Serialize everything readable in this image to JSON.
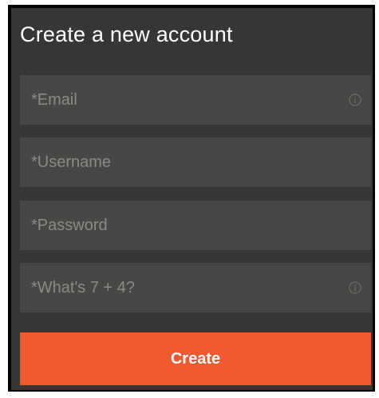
{
  "form": {
    "title": "Create a new account",
    "fields": [
      {
        "placeholder": "*Email",
        "value": "",
        "has_info_icon": true,
        "icon": "info-icon"
      },
      {
        "placeholder": "*Username",
        "value": "",
        "has_info_icon": false
      },
      {
        "placeholder": "*Password",
        "value": "",
        "has_info_icon": false
      },
      {
        "placeholder": "*What's 7 + 4?",
        "value": "",
        "has_info_icon": true,
        "icon": "info-icon"
      }
    ],
    "submit_label": "Create"
  },
  "colors": {
    "panel_background": "#373634",
    "field_background": "#484745",
    "placeholder_text": "#8b8a87",
    "title_text": "#ffffff",
    "accent_button": "#f05a2e",
    "button_text": "#ffffff",
    "info_icon": "#6b6a67"
  }
}
